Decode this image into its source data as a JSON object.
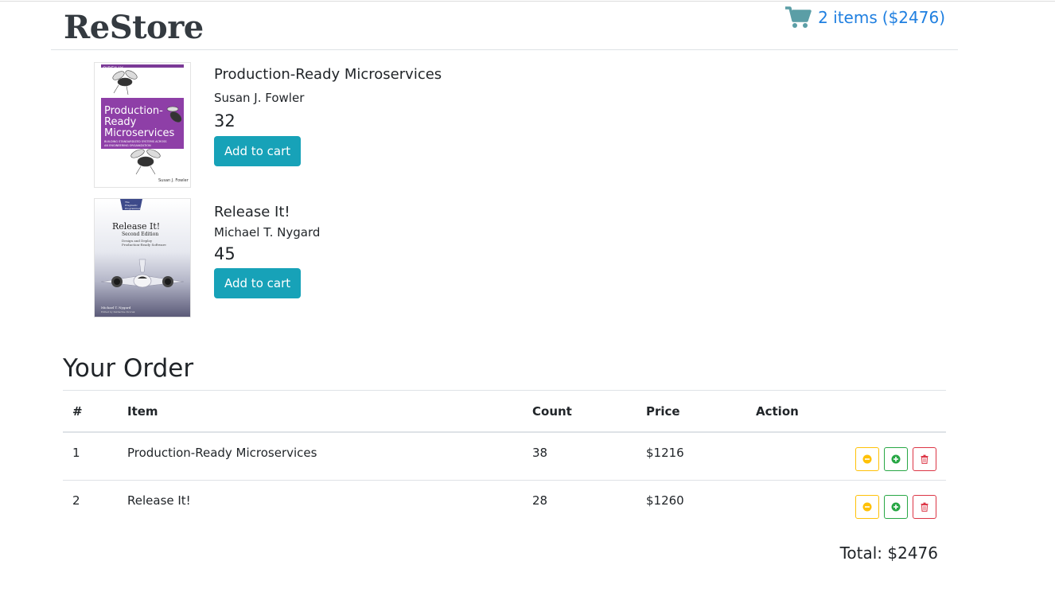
{
  "header": {
    "logo": "ReStore",
    "cart_icon": "shopping-cart-icon",
    "cart_count": "2 items",
    "cart_total": "($2476)"
  },
  "books": [
    {
      "title": "Production-Ready Microservices",
      "author": "Susan J. Fowler",
      "price": "32",
      "button": "Add to cart",
      "cover": {
        "publisher": "O'REILLY",
        "title_lines": [
          "Production-",
          "Ready",
          "Microservices"
        ],
        "subtitle_lines": [
          "BUILDING STANDARDIZED SYSTEMS ACROSS",
          "AN ENGINEERING ORGANIZATION"
        ],
        "author": "Susan J. Fowler"
      }
    },
    {
      "title": "Release It!",
      "author": "Michael T. Nygard",
      "price": "45",
      "button": "Add to cart",
      "cover": {
        "publisher_lines": [
          "The",
          "Pragmatic",
          "Programmers"
        ],
        "title": "Release It!",
        "edition": "Second Edition",
        "subtitle_lines": [
          "Design and Deploy",
          "Production-Ready Software"
        ],
        "author": "Michael T. Nygard",
        "editor": "Edited by Katharine Dvorak"
      }
    }
  ],
  "order": {
    "heading": "Your Order",
    "columns": [
      "#",
      "Item",
      "Count",
      "Price",
      "Action"
    ],
    "rows": [
      {
        "num": "1",
        "item": "Production-Ready Microservices",
        "count": "38",
        "price": "$1216"
      },
      {
        "num": "2",
        "item": "Release It!",
        "count": "28",
        "price": "$1260"
      }
    ],
    "action_icons": [
      "minus-circle-icon",
      "plus-circle-icon",
      "trash-icon"
    ],
    "total": "Total: $2476"
  },
  "colors": {
    "accent_link": "#1f7fe0",
    "cart_icon": "#5b9ea6",
    "button": "#17a2b8",
    "warning": "#ffc107",
    "success": "#28a745",
    "danger": "#dc3545"
  }
}
